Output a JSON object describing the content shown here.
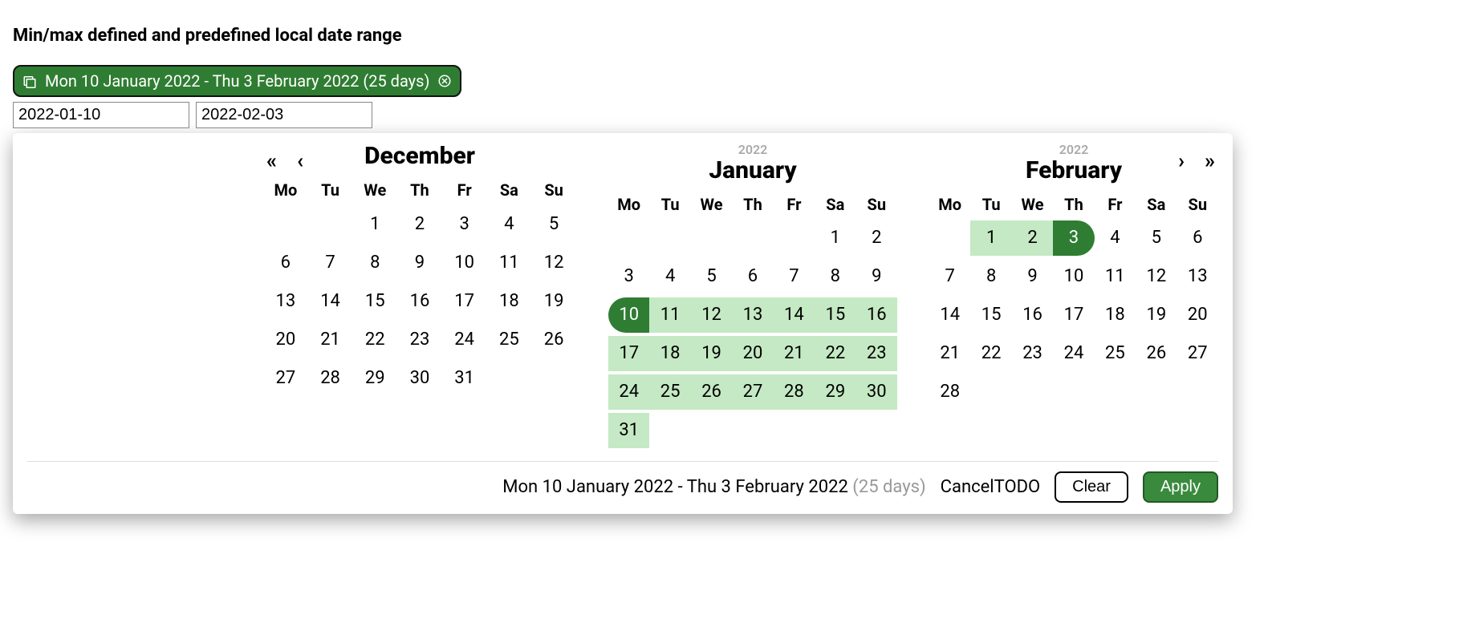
{
  "heading": "Min/max defined and predefined local date range",
  "chip": {
    "text": "Mon 10 January 2022 - Thu 3 February 2022 (25 days)"
  },
  "inputs": {
    "start": "2022-01-10",
    "end": "2022-02-03"
  },
  "weekday_labels": [
    "Mo",
    "Tu",
    "We",
    "Th",
    "Fr",
    "Sa",
    "Su"
  ],
  "months": [
    {
      "id": "dec",
      "year": "",
      "name": "December",
      "nav_prev_year": "«",
      "nav_prev_month": "‹",
      "weeks": [
        [
          "",
          "",
          "1",
          "2",
          "3",
          "4",
          "5"
        ],
        [
          "6",
          "7",
          "8",
          "9",
          "10",
          "11",
          "12"
        ],
        [
          "13",
          "14",
          "15",
          "16",
          "17",
          "18",
          "19"
        ],
        [
          "20",
          "21",
          "22",
          "23",
          "24",
          "25",
          "26"
        ],
        [
          "27",
          "28",
          "29",
          "30",
          "31",
          "",
          ""
        ]
      ]
    },
    {
      "id": "jan",
      "year": "2022",
      "name": "January",
      "weeks": [
        [
          "",
          "",
          "",
          "",
          "",
          "1",
          "2"
        ],
        [
          "3",
          "4",
          "5",
          "6",
          "7",
          "8",
          "9"
        ],
        [
          "10",
          "11",
          "12",
          "13",
          "14",
          "15",
          "16"
        ],
        [
          "17",
          "18",
          "19",
          "20",
          "21",
          "22",
          "23"
        ],
        [
          "24",
          "25",
          "26",
          "27",
          "28",
          "29",
          "30"
        ],
        [
          "31",
          "",
          "",
          "",
          "",
          "",
          ""
        ]
      ],
      "range_start_day": 10,
      "range_days": [
        11,
        12,
        13,
        14,
        15,
        16,
        17,
        18,
        19,
        20,
        21,
        22,
        23,
        24,
        25,
        26,
        27,
        28,
        29,
        30,
        31
      ]
    },
    {
      "id": "feb",
      "year": "2022",
      "name": "February",
      "nav_next_month": "›",
      "nav_next_year": "»",
      "weeks": [
        [
          "",
          "1",
          "2",
          "3",
          "4",
          "5",
          "6"
        ],
        [
          "7",
          "8",
          "9",
          "10",
          "11",
          "12",
          "13"
        ],
        [
          "14",
          "15",
          "16",
          "17",
          "18",
          "19",
          "20"
        ],
        [
          "21",
          "22",
          "23",
          "24",
          "25",
          "26",
          "27"
        ],
        [
          "28",
          "",
          "",
          "",
          "",
          "",
          ""
        ]
      ],
      "range_end_day": 3,
      "range_days": [
        1,
        2
      ]
    }
  ],
  "footer": {
    "summary_range": "Mon 10 January 2022 - Thu 3 February 2022",
    "summary_days": "(25 days)",
    "cancel_text": "CancelTODO",
    "clear_label": "Clear",
    "apply_label": "Apply"
  }
}
